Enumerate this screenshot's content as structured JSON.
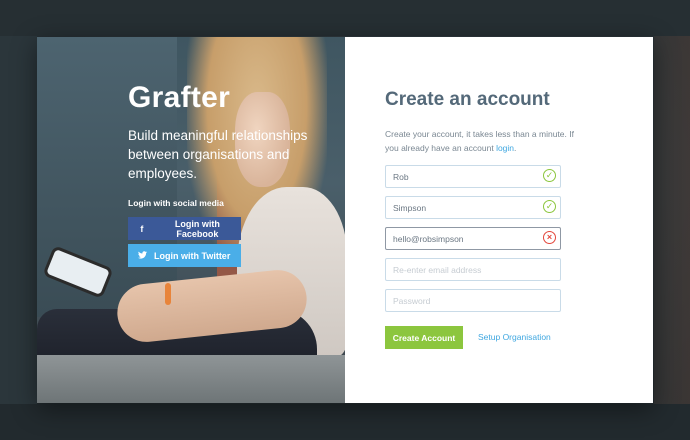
{
  "brand": "Grafter",
  "tagline": "Build meaningful relationships between organisations and employees.",
  "social": {
    "label": "Login with social media",
    "facebook": {
      "label": "Login with Facebook",
      "icon": "facebook-icon",
      "color": "#3b5998"
    },
    "twitter": {
      "label": "Login with Twitter",
      "icon": "twitter-icon",
      "color": "#4aaee8"
    }
  },
  "form": {
    "title": "Create an account",
    "subtitle": "Create your account, it takes less than a minute. If you already have an account",
    "login_link": "login",
    "subtitle_end": ".",
    "fields": [
      {
        "name": "first-name",
        "value": "Rob",
        "placeholder": "",
        "status": "valid"
      },
      {
        "name": "last-name",
        "value": "Simpson",
        "placeholder": "",
        "status": "valid"
      },
      {
        "name": "email",
        "value": "hello@robsimpson",
        "placeholder": "",
        "status": "invalid"
      },
      {
        "name": "email-confirm",
        "value": "",
        "placeholder": "Re-enter email address",
        "status": ""
      },
      {
        "name": "password",
        "value": "",
        "placeholder": "Password",
        "status": ""
      }
    ],
    "submit_label": "Create Account",
    "secondary_link": "Setup Organisation"
  },
  "colors": {
    "accent_green": "#8cc63e",
    "link_blue": "#3fa7e0",
    "error_red": "#e3473c",
    "title_slate": "#546979"
  }
}
